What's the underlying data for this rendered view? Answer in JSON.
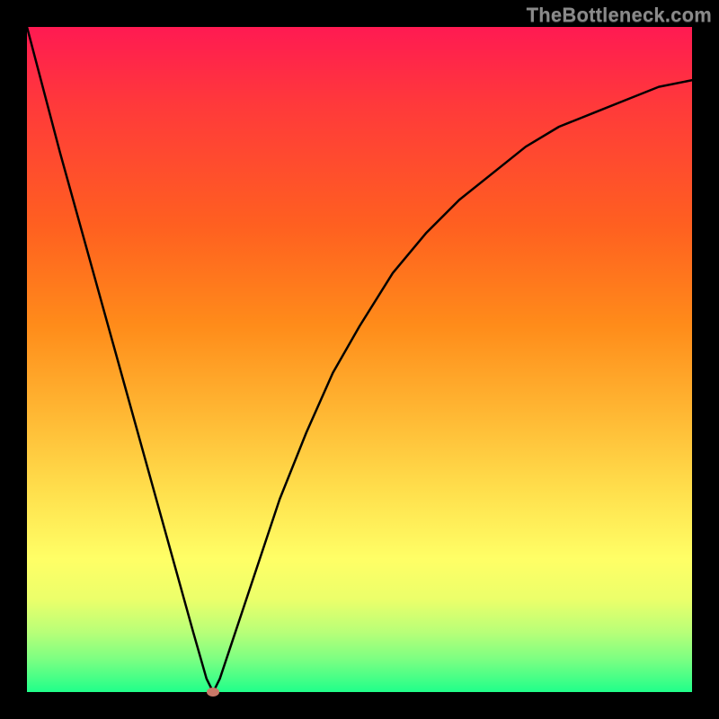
{
  "watermark": "TheBottleneck.com",
  "chart_data": {
    "type": "line",
    "title": "",
    "xlabel": "",
    "ylabel": "",
    "xlim": [
      0,
      100
    ],
    "ylim": [
      0,
      100
    ],
    "grid": false,
    "legend": false,
    "series": [
      {
        "name": "bottleneck-curve",
        "x": [
          0,
          5,
          10,
          15,
          20,
          25,
          27,
          28,
          29,
          30,
          32,
          35,
          38,
          42,
          46,
          50,
          55,
          60,
          65,
          70,
          75,
          80,
          85,
          90,
          95,
          100
        ],
        "y": [
          100,
          81,
          63,
          45,
          27,
          9,
          2,
          0,
          2,
          5,
          11,
          20,
          29,
          39,
          48,
          55,
          63,
          69,
          74,
          78,
          82,
          85,
          87,
          89,
          91,
          92
        ]
      }
    ],
    "marker": {
      "name": "optimal-point",
      "x": 28,
      "y": 0,
      "color": "#c97868"
    },
    "background_gradient": {
      "stops": [
        {
          "pos": 0,
          "color": "#ff1a52"
        },
        {
          "pos": 12,
          "color": "#ff3a3a"
        },
        {
          "pos": 30,
          "color": "#ff6020"
        },
        {
          "pos": 45,
          "color": "#ff8c1a"
        },
        {
          "pos": 58,
          "color": "#ffb733"
        },
        {
          "pos": 70,
          "color": "#ffe04d"
        },
        {
          "pos": 80,
          "color": "#ffff66"
        },
        {
          "pos": 86,
          "color": "#ecff6a"
        },
        {
          "pos": 91,
          "color": "#b8ff78"
        },
        {
          "pos": 95,
          "color": "#7dff82"
        },
        {
          "pos": 100,
          "color": "#20ff8a"
        }
      ]
    }
  }
}
